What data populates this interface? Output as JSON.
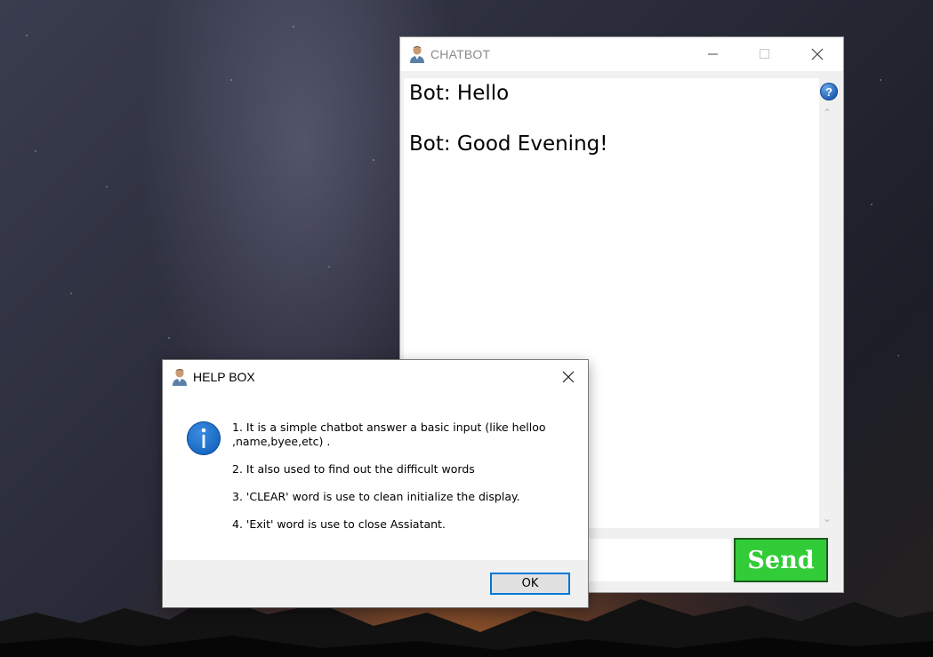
{
  "chat_window": {
    "title": "CHATBOT",
    "title_icon": "user-avatar-icon",
    "controls": [
      "minimize",
      "maximize",
      "close"
    ],
    "messages": [
      "Bot: Hello",
      "Bot: Good Evening!"
    ],
    "input_value": "",
    "send_label": "Send",
    "send_color": "#31cc37",
    "help_icon": "question-icon"
  },
  "help_dialog": {
    "title": "HELP BOX",
    "title_icon": "user-avatar-icon",
    "icon": "info-icon",
    "items": [
      "1. It is a simple chatbot answer a basic input (like helloo ,name,byee,etc) .",
      "2. It also used to find out the difficult words",
      "3. 'CLEAR' word is use to clean initialize the display.",
      "4. 'Exit' word is use to close Assiatant."
    ],
    "ok_label": "OK",
    "ok_border_color": "#0078d7"
  }
}
